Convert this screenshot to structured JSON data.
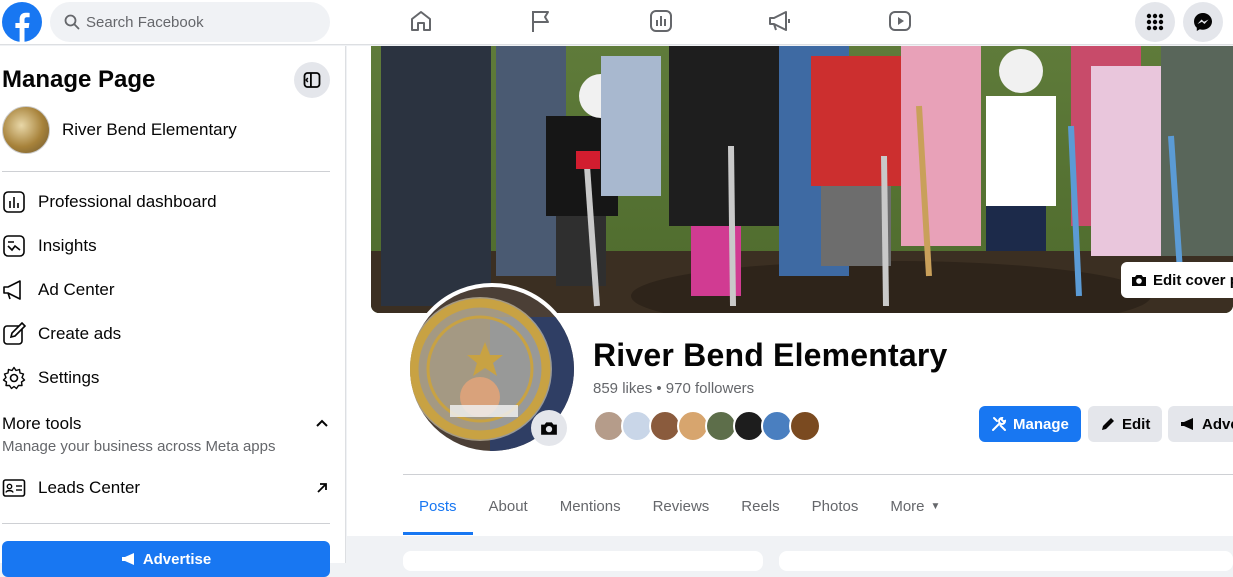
{
  "topbar": {
    "search_placeholder": "Search Facebook",
    "nav_icons": [
      "home-icon",
      "flag-icon",
      "chart-icon",
      "megaphone-icon",
      "video-icon"
    ],
    "right_icons": [
      "menu-grid-icon",
      "messenger-icon"
    ]
  },
  "sidebar": {
    "title": "Manage Page",
    "page_name": "River Bend Elementary",
    "items": [
      {
        "label": "Professional dashboard",
        "icon": "dashboard-icon"
      },
      {
        "label": "Insights",
        "icon": "insights-icon"
      },
      {
        "label": "Ad Center",
        "icon": "megaphone-icon"
      },
      {
        "label": "Create ads",
        "icon": "pencil-square-icon"
      },
      {
        "label": "Settings",
        "icon": "gear-icon"
      }
    ],
    "more_tools": {
      "title": "More tools",
      "subtitle": "Manage your business across Meta apps"
    },
    "leads_center": "Leads Center",
    "advertise_label": "Advertise"
  },
  "profile": {
    "name": "River Bend Elementary",
    "likes_followers": "859 likes • 970 followers",
    "edit_cover_label": "Edit cover p",
    "manage_label": "Manage",
    "edit_label": "Edit",
    "advertise_label": "Adve",
    "fan_avatar_colors": [
      "#b59c8a",
      "#c9d6e8",
      "#8a5b3d",
      "#d7a56e",
      "#5d6e4a",
      "#1d1d1d",
      "#4a7fc0",
      "#7a4a20"
    ]
  },
  "tabs": [
    "Posts",
    "About",
    "Mentions",
    "Reviews",
    "Reels",
    "Photos",
    "More"
  ],
  "colors": {
    "accent": "#1877f2",
    "background": "#f0f2f5",
    "secondary_text": "#65676b"
  }
}
